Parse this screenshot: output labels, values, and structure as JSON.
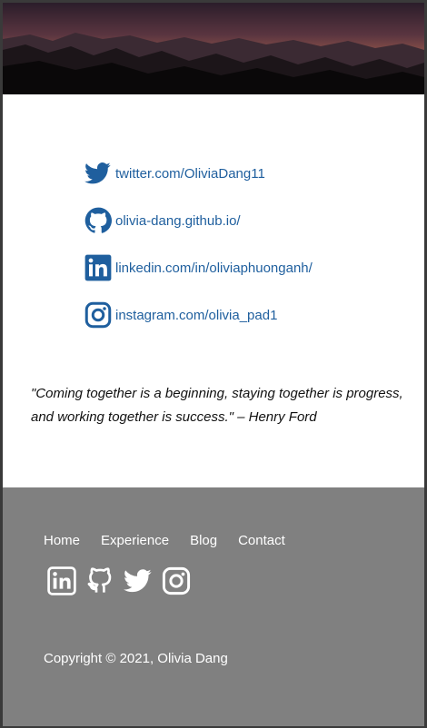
{
  "social_links": [
    {
      "label": "twitter.com/OliviaDang11",
      "icon": "twitter-icon"
    },
    {
      "label": "olivia-dang.github.io/",
      "icon": "github-icon"
    },
    {
      "label": "linkedin.com/in/oliviaphuonganh/",
      "icon": "linkedin-icon"
    },
    {
      "label": "instagram.com/olivia_pad1",
      "icon": "instagram-icon"
    }
  ],
  "quote": {
    "text": "\"Coming together is a beginning, staying together is progress, and working together is success.\" – Henry Ford"
  },
  "footer": {
    "nav": [
      "Home",
      "Experience",
      "Blog",
      "Contact"
    ],
    "icons": [
      "linkedin-icon",
      "github-icon",
      "twitter-icon",
      "instagram-icon"
    ],
    "copyright": "Copyright © 2021, Olivia Dang"
  },
  "colors": {
    "link": "#1f5f9e",
    "footer_bg": "#808080",
    "footer_text": "#ffffff"
  }
}
